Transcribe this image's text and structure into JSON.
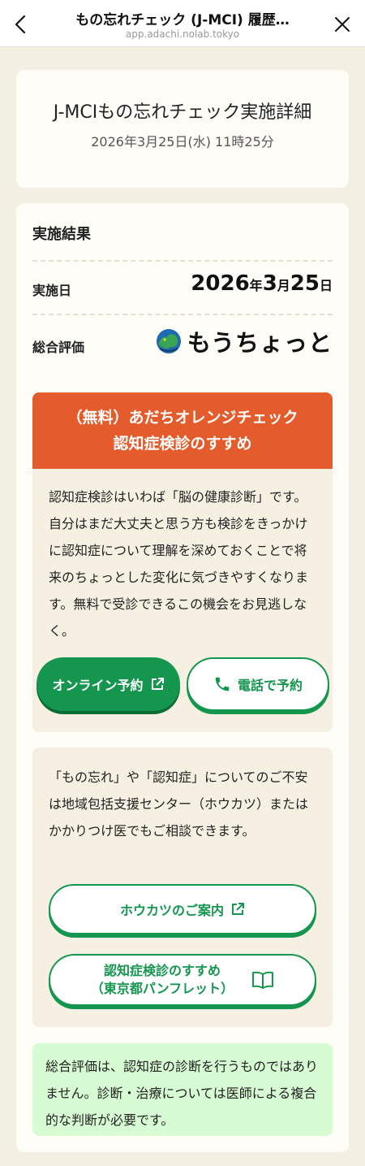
{
  "browser": {
    "title": "もの忘れチェック (J-MCI) 履歴…",
    "url": "app.adachi.nolab.tokyo"
  },
  "header": {
    "title": "J-MCIもの忘れチェック実施詳細",
    "datetime": "2026年3月25日(水) 11時25分"
  },
  "result": {
    "section_title": "実施結果",
    "date_label": "実施日",
    "date_year": "2026",
    "date_year_unit": "年",
    "date_month": "3",
    "date_month_unit": "月",
    "date_day": "25",
    "date_day_unit": "日",
    "eval_label": "総合評価",
    "eval_value": "もうちょっと",
    "eval_icon": "globe-brain-icon"
  },
  "recommend": {
    "title_line1": "（無料）あだちオレンジチェック",
    "title_line2": "認知症検診のすすめ",
    "body": "認知症検診はいわば「脳の健康診断」です。自分はまだ大丈夫と思う方も検診をきっかけに認知症について理解を深めておくことで将来のちょっとした変化に気づきやすくなります。無料で受診できるこの機会をお見逃しなく。",
    "online_button": "オンライン予約",
    "phone_button": "電話で予約",
    "accent": "#e45b2c",
    "green": "#15964f"
  },
  "consult": {
    "body": "「もの忘れ」や「認知症」についてのご不安は地域包括支援センター（ホウカツ）またはかかりつけ医でもご相談できます。",
    "houkatsu_button": "ホウカツのご案内",
    "pamphlet_line1": "認知症検診のすすめ",
    "pamphlet_line2": "（東京都パンフレット）"
  },
  "notice": {
    "text": "総合評価は、認知症の診断を行うものではありません。診断・治療については医師による複合的な判断が必要です。"
  }
}
